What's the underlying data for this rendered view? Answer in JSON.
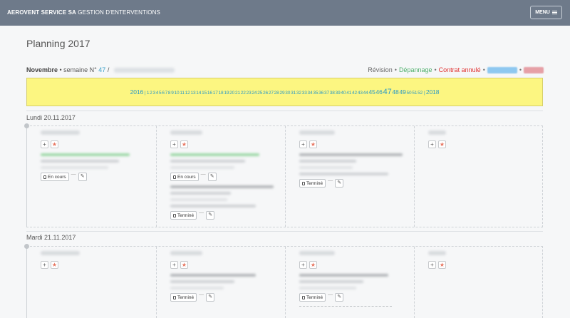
{
  "header": {
    "company": "AEROVENT SERVICE SA",
    "module": "GESTION D'ENTERVENTIONS",
    "menu_label": "MENU"
  },
  "page": {
    "title": "Planning 2017"
  },
  "period": {
    "month": "Novembre",
    "separator": " • semaine N° ",
    "week": "47",
    "slash": " /"
  },
  "legend": {
    "revision": "Révision",
    "depannage": "Dépannage",
    "contrat_annule": "Contrat annulé",
    "bullet": "•",
    "colors": {
      "revision": "#666666",
      "depannage": "#4caf6a",
      "contrat_annule": "#e03030",
      "blue": "#8ec8f0",
      "red": "#e6a0a6"
    }
  },
  "weekbar": {
    "prev_year": "2016",
    "next_year": "2018",
    "weeks": [
      "1",
      "2",
      "3",
      "4",
      "5",
      "6",
      "7",
      "8",
      "9",
      "10",
      "11",
      "12",
      "13",
      "14",
      "15",
      "16",
      "17",
      "18",
      "19",
      "20",
      "21",
      "22",
      "23",
      "24",
      "25",
      "26",
      "27",
      "28",
      "29",
      "30",
      "31",
      "32",
      "33",
      "34",
      "35",
      "36",
      "37",
      "38",
      "39",
      "40",
      "41",
      "42",
      "43",
      "44",
      "45",
      "46",
      "47",
      "48",
      "49",
      "50",
      "51",
      "52"
    ],
    "current": "47",
    "accent": "#2a9ac6",
    "background": "#fcf681"
  },
  "days": [
    {
      "label": "Lundi 20.11.2017",
      "columns": [
        {
          "status": "En cours",
          "tasks": 1
        },
        {
          "status": "En cours",
          "status2": "Terminé",
          "tasks": 2
        },
        {
          "status": "Terminé",
          "tasks": 1
        },
        {
          "tasks": 0
        }
      ]
    },
    {
      "label": "Mardi 21.11.2017",
      "columns": [
        {
          "tasks": 0
        },
        {
          "status": "Terminé",
          "tasks": 1
        },
        {
          "status": "Terminé",
          "tasks": 1
        },
        {
          "tasks": 0
        }
      ]
    }
  ],
  "buttons": {
    "add": "+",
    "favorite": "★",
    "dash": "—",
    "edit": "✎"
  }
}
